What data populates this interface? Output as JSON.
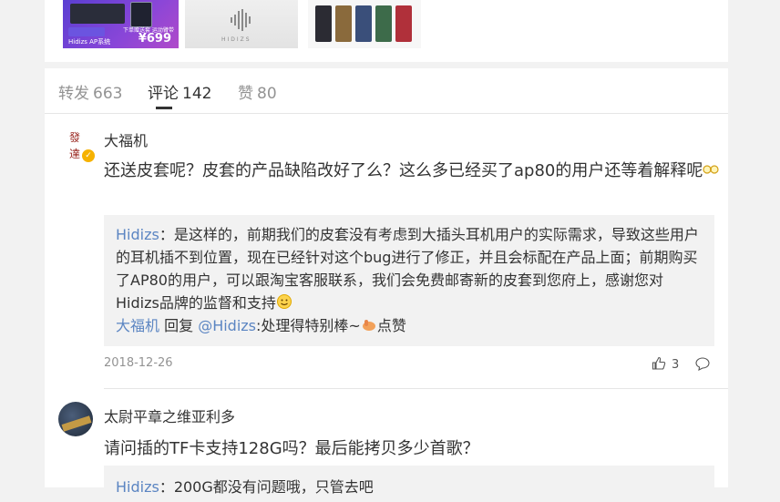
{
  "thumbnails": {
    "thumb1": {
      "price": "¥699",
      "text": "Hidizs AP系统",
      "sale": "下单赠送套\n运动臂带"
    },
    "thumb2": {
      "brand": "HIDIZS"
    }
  },
  "tabs": [
    {
      "label": "转发",
      "count": "663"
    },
    {
      "label": "评论",
      "count": "142"
    },
    {
      "label": "赞",
      "count": "80"
    }
  ],
  "comments": [
    {
      "author": "大福机",
      "avatar_text": "發\n達",
      "verified": true,
      "text": "还送皮套呢？皮套的产品缺陷改好了么？这么多已经买了ap80的用户还等着解释呢",
      "emoji": "glasses-emoji",
      "reply": {
        "author": "Hidizs",
        "sep": "：",
        "text": "是这样的，前期我们的皮套没有考虑到大插头耳机用户的实际需求，导致这些用户的耳机插不到位置，现在已经针对这个bug进行了修正，并且会标配在产品上面；前期购买了AP80的用户，可以跟淘宝客服联系，我们会免费邮寄新的皮套到您府上，感谢您对Hidizs品牌的监督和支持",
        "emoji": "smile-emoji",
        "sub_author": "大福机",
        "sub_verb": " 回复 ",
        "sub_target": "@Hidizs",
        "sub_text": ":处理得特别棒~",
        "sub_emoji": "thumb-emoji",
        "sub_tail": "点赞"
      },
      "date": "2018-12-26",
      "likes": "3"
    },
    {
      "author": "太尉平章之维亚利多",
      "text": "请问插的TF卡支持128G吗？最后能拷贝多少首歌？",
      "reply": {
        "author": "Hidizs",
        "text": "：200G都没有问题哦，只管去吧"
      }
    }
  ],
  "colors": {
    "link": "#5b85c2",
    "muted": "#939393",
    "verified_badge": "#f6b200"
  }
}
